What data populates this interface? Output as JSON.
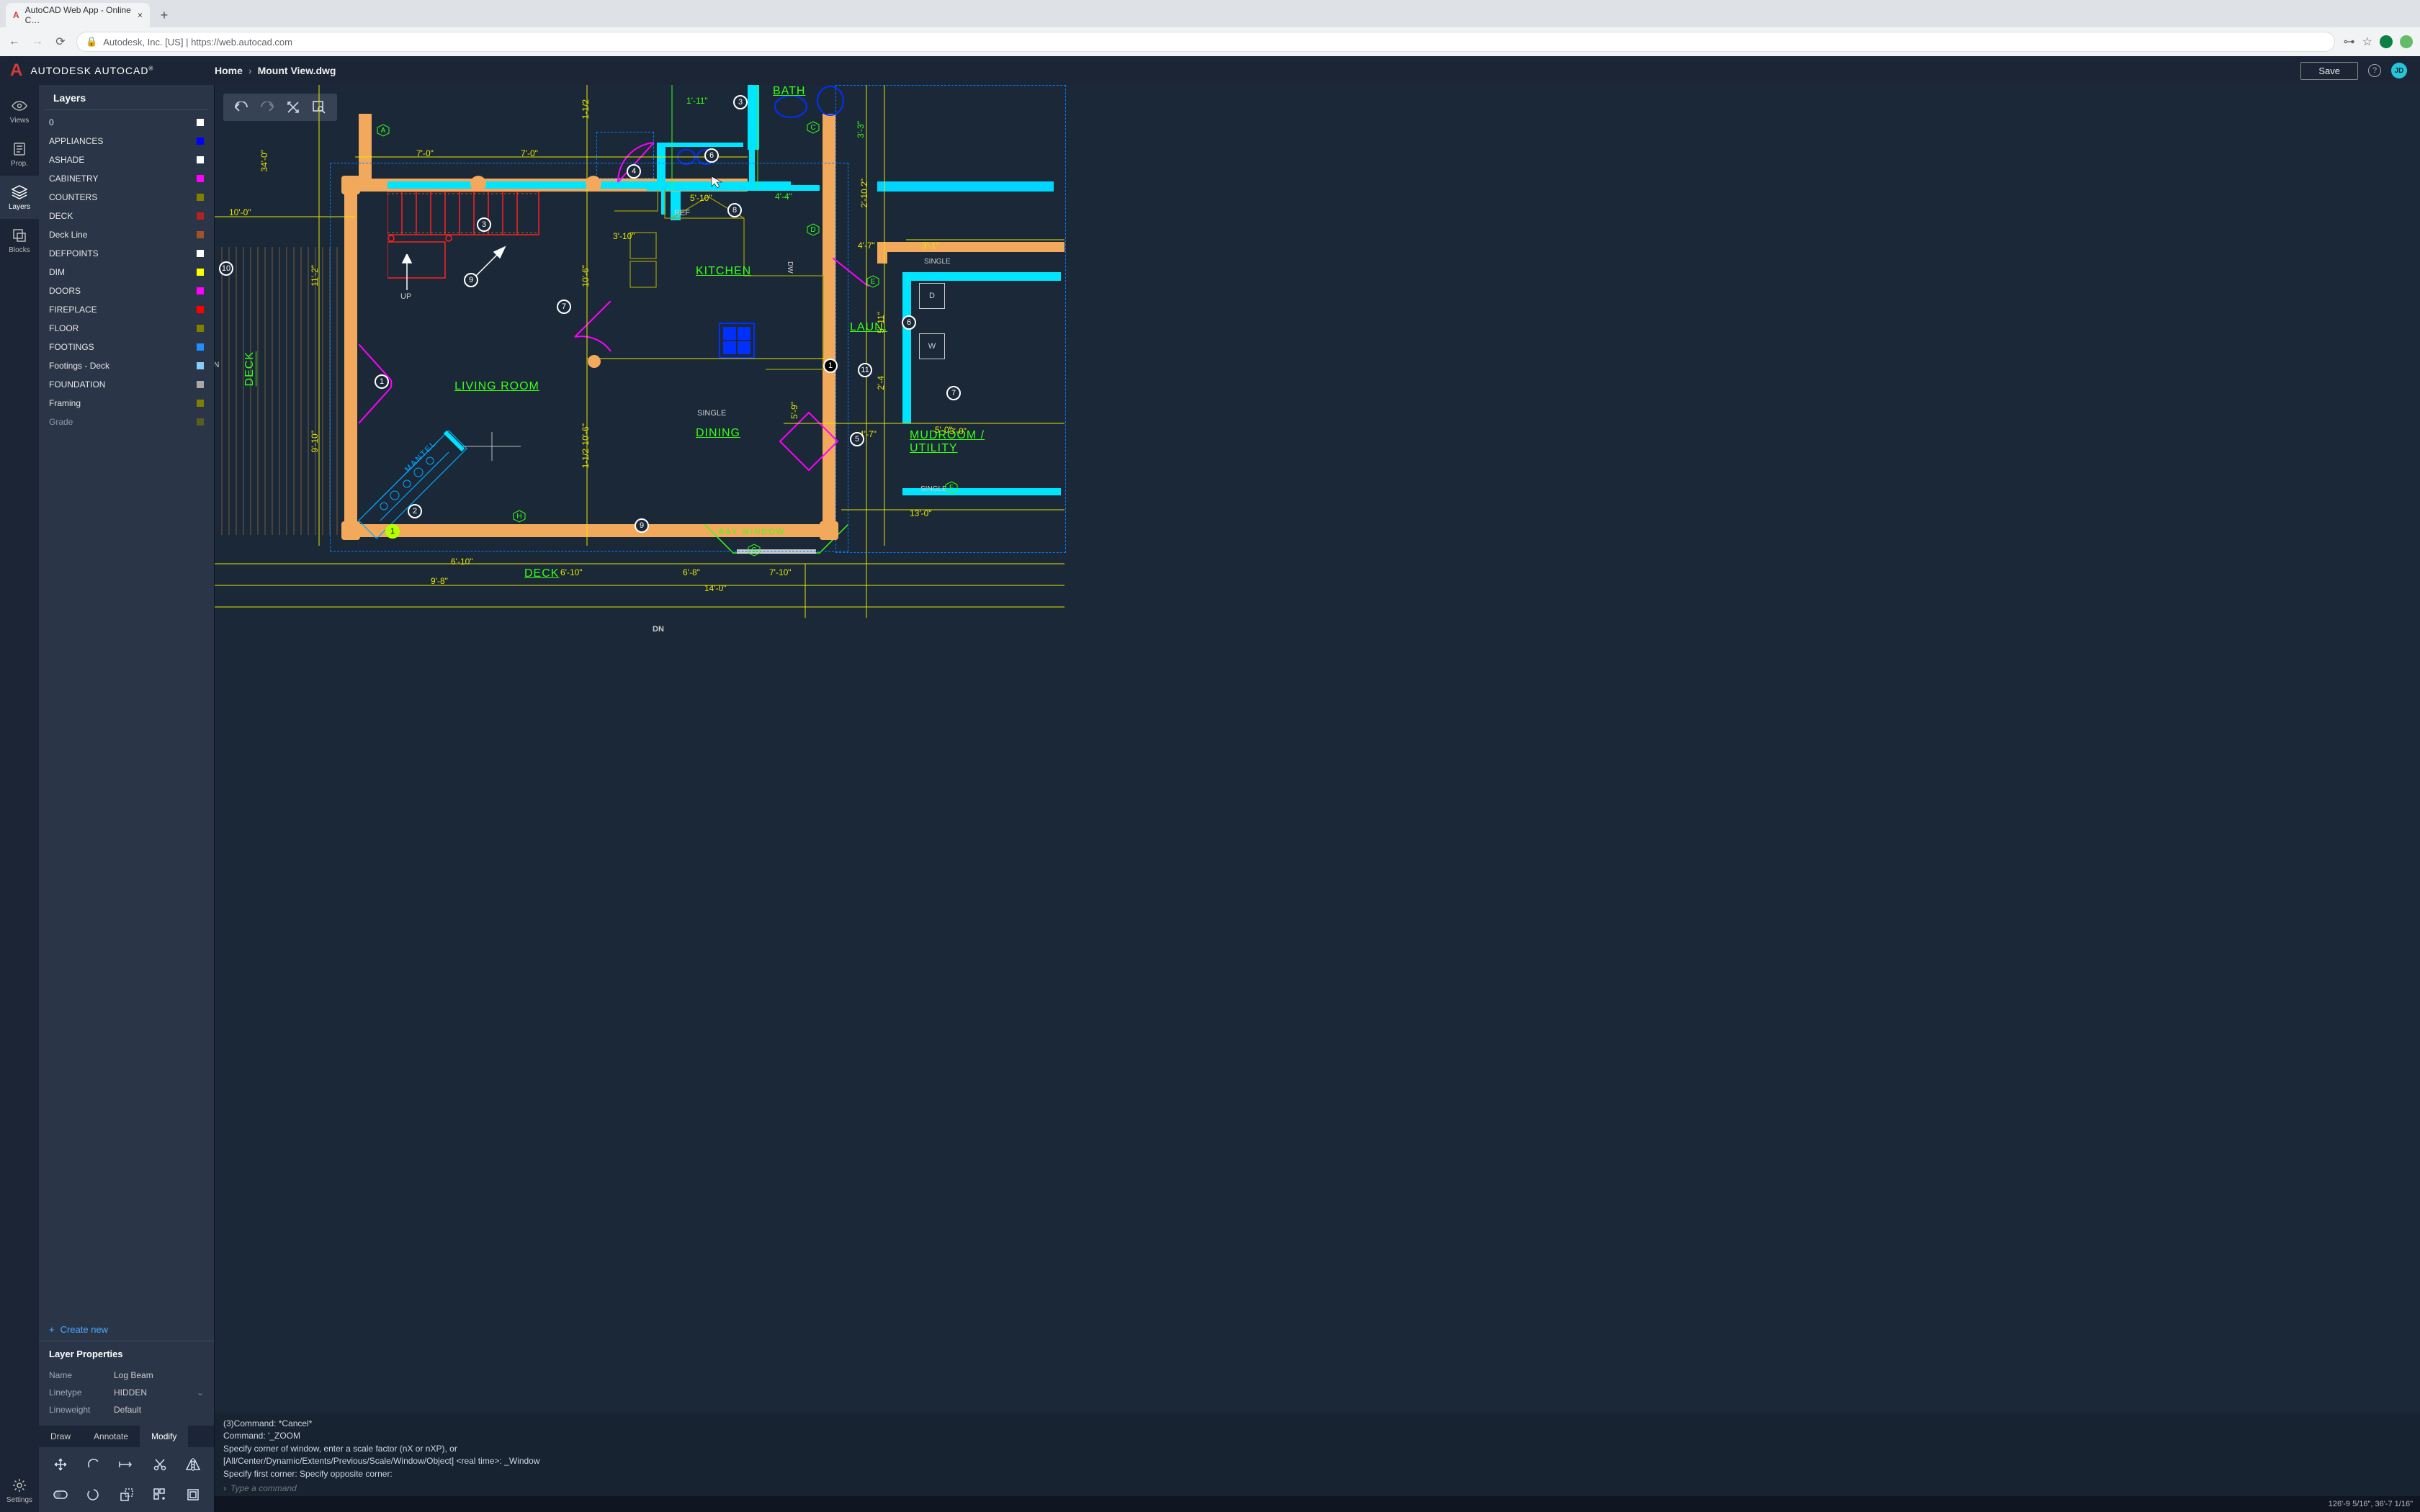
{
  "browser": {
    "tab_title": "AutoCAD Web App - Online C…",
    "url_display": "Autodesk, Inc. [US] | https://web.autocad.com"
  },
  "header": {
    "brand_main": "AUTODESK",
    "brand_sub": "AUTOCAD",
    "breadcrumb_home": "Home",
    "breadcrumb_file": "Mount View.dwg",
    "save": "Save",
    "user_initials": "JD"
  },
  "rail": {
    "views": "Views",
    "prop": "Prop.",
    "layers": "Layers",
    "blocks": "Blocks",
    "settings": "Settings"
  },
  "panel": {
    "title": "Layers",
    "create_new": "Create new",
    "layers": [
      {
        "name": "0",
        "color": "#ffffff"
      },
      {
        "name": "APPLIANCES",
        "color": "#0000ff"
      },
      {
        "name": "ASHADE",
        "color": "#ffffff"
      },
      {
        "name": "CABINETRY",
        "color": "#ff00ff"
      },
      {
        "name": "COUNTERS",
        "color": "#808000"
      },
      {
        "name": "DECK",
        "color": "#b22222"
      },
      {
        "name": "Deck Line",
        "color": "#a0522d"
      },
      {
        "name": "DEFPOINTS",
        "color": "#ffffff"
      },
      {
        "name": "DIM",
        "color": "#ffff00"
      },
      {
        "name": "DOORS",
        "color": "#ff00ff"
      },
      {
        "name": "FIREPLACE",
        "color": "#ff0000"
      },
      {
        "name": "FLOOR",
        "color": "#808000"
      },
      {
        "name": "FOOTINGS",
        "color": "#1e90ff"
      },
      {
        "name": "Footings - Deck",
        "color": "#87cefa"
      },
      {
        "name": "FOUNDATION",
        "color": "#a9a9a9"
      },
      {
        "name": "Framing",
        "color": "#808000"
      },
      {
        "name": "Grade",
        "color": "#808000"
      }
    ],
    "properties_title": "Layer Properties",
    "prop_name_k": "Name",
    "prop_name_v": "Log Beam",
    "prop_line_k": "Linetype",
    "prop_line_v": "HIDDEN",
    "prop_wt_k": "Lineweight",
    "prop_wt_v": "Default"
  },
  "edit_tabs": {
    "draw": "Draw",
    "annotate": "Annotate",
    "modify": "Modify"
  },
  "canvas": {
    "rooms": {
      "living": "LIVING ROOM",
      "dining": "DINING",
      "kitchen": "KITCHEN",
      "bath": "BATH",
      "laun": "LAUN.",
      "mudroom": "MUDROOM / UTILITY",
      "deck_left": "DECK",
      "deck_bottom": "DECK"
    },
    "labels": {
      "up": "UP",
      "ref": "REF",
      "dw": "DW",
      "w_box": "W",
      "d_box": "D",
      "on": "ON",
      "single_top": "SINGLE",
      "single_mid": "SINGLE",
      "single_bot": "SINGLE",
      "bay_window": "BAY  WINDOW",
      "mantel": "MANTEL",
      "dn": "DN"
    },
    "dims": {
      "d10_0": "10'-0\"",
      "d7_0a": "7'-0\"",
      "d7_0b": "7'-0\"",
      "d34_0": "34'-0\"",
      "d11_2": "11'-2\"",
      "d9_10": "9'-10\"",
      "d3_10": "3'-10\"",
      "d10_6a": "10'-6\"",
      "d1_12a": "1-1/2",
      "d1_12b": "1-1/2",
      "d10_6b": "10'-6\"",
      "d5_10": "5'-10\"",
      "d1_11": "1'-11\"",
      "d4_4": "4'-4\"",
      "d2_10": "2'-10 2\"",
      "d4_7": "4'-7\"",
      "d3_1": "3'-1\"",
      "d5_11": "5'-11\"",
      "d2_4": "2'-4",
      "d6_10a": "6'-10\"",
      "d6_8": "6'-8\"",
      "d7_10": "7'-10\"",
      "d6_10b": "6'-10\"",
      "d5_0": "5'-0\"",
      "d5_9": "5'-9\"",
      "d3_0": "3'-0\"",
      "d4_7b": "4'-7\"",
      "d13_0": "13'-0\"",
      "d14_0": "14'-0\"",
      "d9_8": "9'-8\"",
      "d3_3": "3'-3\""
    }
  },
  "command": {
    "l1": "(3)Command: *Cancel*",
    "l2": "Command: '_ZOOM",
    "l3": "Specify corner of window, enter a scale factor (nX or nXP), or",
    "l4": "[All/Center/Dynamic/Extents/Previous/Scale/Window/Object] <real time>:  _Window",
    "l5": "Specify first corner: Specify opposite corner:",
    "placeholder": "Type a command"
  },
  "status": {
    "coords": "126'-9 5/16\", 36'-7 1/16\""
  }
}
